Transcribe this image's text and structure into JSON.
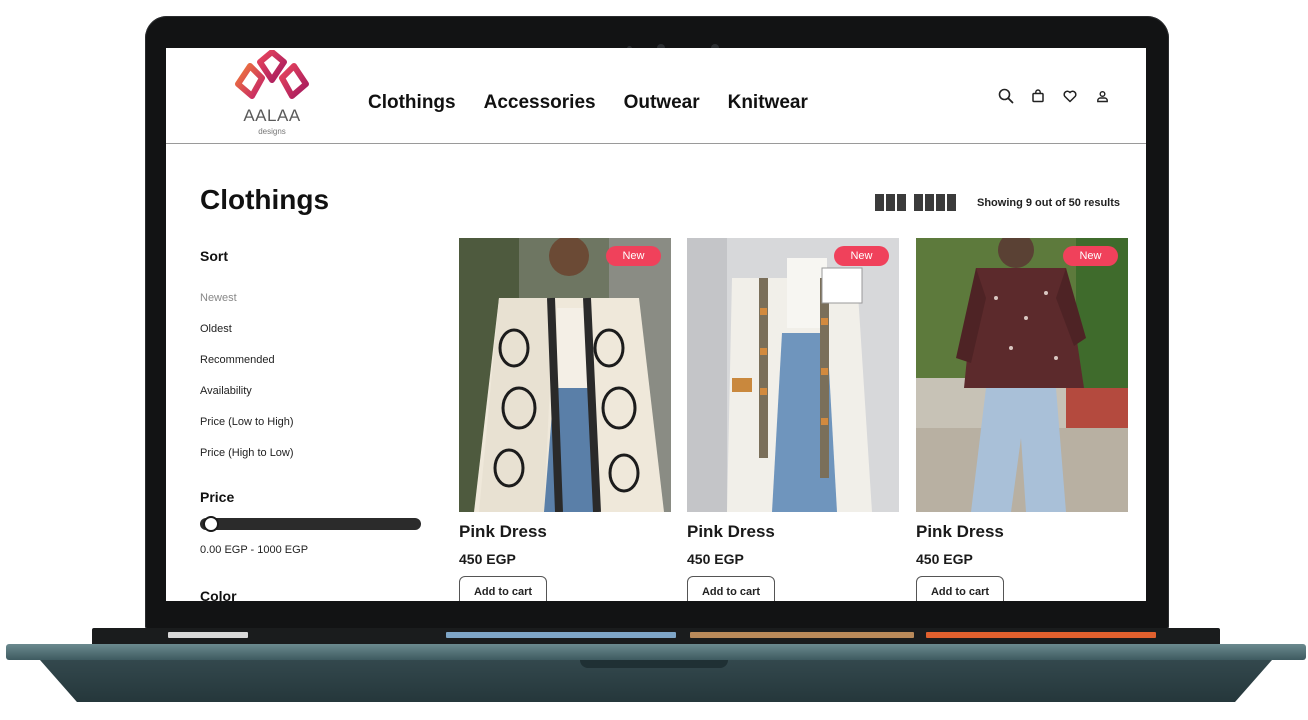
{
  "brand": {
    "name": "AALAA",
    "sub": "designs",
    "colors": [
      "#e8455d",
      "#c3206a",
      "#f07a3a"
    ]
  },
  "nav": {
    "items": [
      "Clothings",
      "Accessories",
      "Outwear",
      "Knitwear"
    ]
  },
  "header_icons": [
    "search-icon",
    "shopping-bag-icon",
    "heart-icon",
    "user-icon"
  ],
  "page": {
    "title": "Clothings",
    "results": "Showing 9 out of 50 results"
  },
  "sidebar": {
    "sort": {
      "heading": "Sort",
      "options": [
        "Newest",
        "Oldest",
        "Recommended",
        "Availability",
        "Price (Low to High)",
        "Price (High to Low)"
      ],
      "selected": "Newest"
    },
    "price": {
      "heading": "Price",
      "range": "0.00 EGP - 1000 EGP",
      "min": 0,
      "max": 1000
    },
    "color": {
      "heading": "Color"
    }
  },
  "products": [
    {
      "badge": "New",
      "name": "Pink Dress",
      "price": "450 EGP",
      "button": "Add to cart"
    },
    {
      "badge": "New",
      "name": "Pink Dress",
      "price": "450 EGP",
      "button": "Add to cart"
    },
    {
      "badge": "New",
      "name": "Pink Dress",
      "price": "450 EGP",
      "button": "Add to cart"
    }
  ],
  "colors": {
    "badge": "#f0415b",
    "text": "#111111",
    "frame": "#121314",
    "base": "#3e5a60"
  }
}
